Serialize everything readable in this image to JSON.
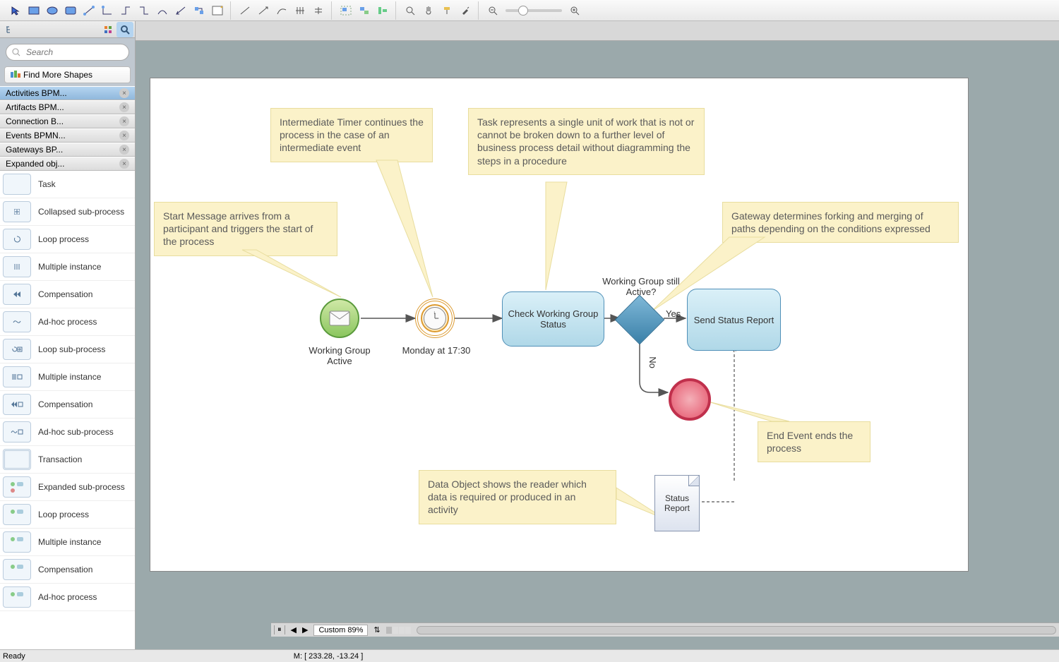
{
  "toolbar": {
    "groups": [
      "pointer",
      "shape-box",
      "shape-oval",
      "shape-rect",
      "connector-1",
      "connector-2",
      "connector-3",
      "connector-4",
      "connector-5",
      "connector-6",
      "connector-7",
      "object-insert",
      "line-1",
      "line-2",
      "line-3",
      "line-4",
      "line-5",
      "group-1",
      "group-2",
      "group-3",
      "zoom-in",
      "pan",
      "format",
      "eyedropper"
    ]
  },
  "sidebar": {
    "search_placeholder": "Search",
    "find_shapes": "Find More Shapes",
    "libs": [
      {
        "label": "Activities BPM...",
        "active": true
      },
      {
        "label": "Artifacts BPM...",
        "active": false
      },
      {
        "label": "Connection B...",
        "active": false
      },
      {
        "label": "Events BPMN...",
        "active": false
      },
      {
        "label": "Gateways BP...",
        "active": false
      },
      {
        "label": "Expanded obj...",
        "active": false
      }
    ],
    "shapes": [
      "Task",
      "Collapsed sub-process",
      "Loop process",
      "Multiple instance",
      "Compensation",
      "Ad-hoc process",
      "Loop sub-process",
      "Multiple instance",
      "Compensation",
      "Ad-hoc sub-process",
      "Transaction",
      "Expanded sub-process",
      "Loop process",
      "Multiple instance",
      "Compensation",
      "Ad-hoc process"
    ]
  },
  "canvas": {
    "notes": {
      "start_msg": "Start Message arrives from a participant and triggers the start of the process",
      "timer": "Intermediate Timer continues the process in the case of an intermediate event",
      "task": "Task represents a single unit of work that is not or cannot be broken down to a further level of business process detail without diagramming the steps in a procedure",
      "gateway": "Gateway determines forking and merging of paths depending on the conditions expressed",
      "data_obj": "Data Object shows the reader which data is required or produced in an activity",
      "end": "End Event ends the process"
    },
    "nodes": {
      "start_label": "Working Group Active",
      "timer_label": "Monday at 17:30",
      "task1": "Check Working Group Status",
      "gateway_q": "Working Group still Active?",
      "edge_yes": "Yes",
      "edge_no": "No",
      "task2": "Send Status Report",
      "doc": "Status Report"
    }
  },
  "status": {
    "ready": "Ready",
    "zoom_label": "Custom 89%",
    "mouse": "M: [ 233.28, -13.24 ]"
  }
}
